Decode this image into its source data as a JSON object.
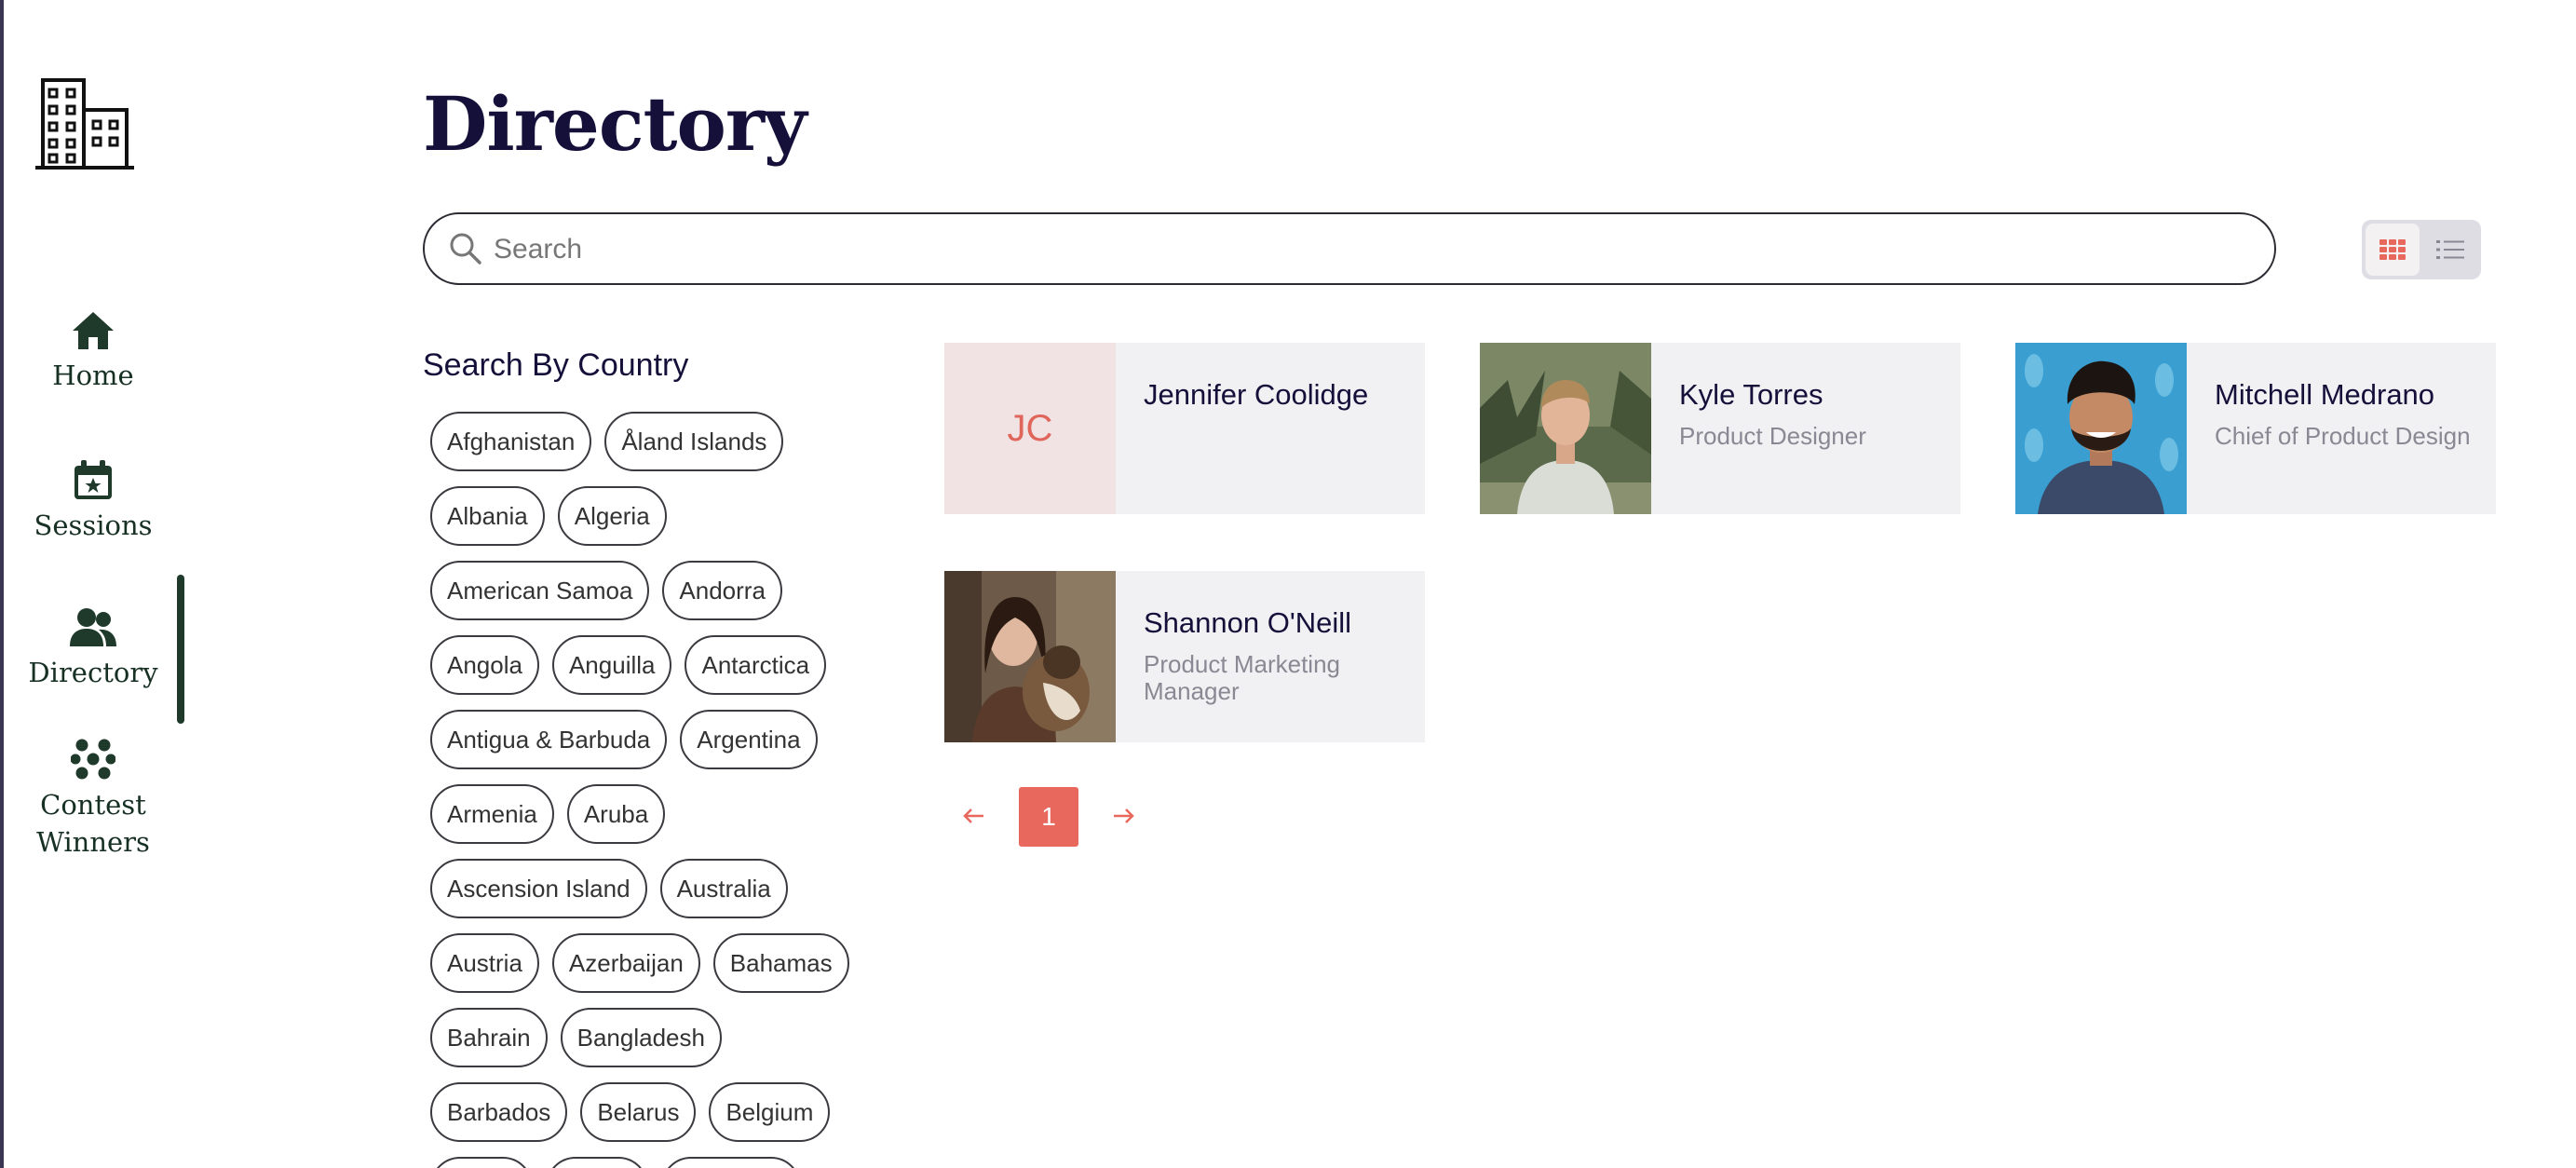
{
  "sidebar": {
    "logo_icon": "building-icon",
    "items": [
      {
        "label": "Home",
        "icon": "home-icon"
      },
      {
        "label": "Sessions",
        "icon": "calendar-star-icon"
      },
      {
        "label": "Directory",
        "icon": "people-icon",
        "active": true
      },
      {
        "label_line1": "Contest",
        "label_line2": "Winners",
        "icon": "dots-cluster-icon"
      }
    ]
  },
  "main": {
    "title": "Directory",
    "search": {
      "placeholder": "Search",
      "value": ""
    },
    "view_toggle": {
      "selected": "grid",
      "options": [
        "grid-icon",
        "list-icon"
      ]
    }
  },
  "filter": {
    "title": "Search By Country",
    "countries": [
      "Afghanistan",
      "Åland Islands",
      "Albania",
      "Algeria",
      "American Samoa",
      "Andorra",
      "Angola",
      "Anguilla",
      "Antarctica",
      "Antigua & Barbuda",
      "Argentina",
      "Armenia",
      "Aruba",
      "Ascension Island",
      "Australia",
      "Austria",
      "Azerbaijan",
      "Bahamas",
      "Bahrain",
      "Bangladesh",
      "Barbados",
      "Belarus",
      "Belgium"
    ]
  },
  "directory": {
    "people": [
      {
        "name": "Jennifer Coolidge",
        "role": "",
        "initials": "JC",
        "photo": "initials"
      },
      {
        "name": "Kyle Torres",
        "role": "Product Designer",
        "photo": "photo"
      },
      {
        "name": "Mitchell Medrano",
        "role": "Chief of Product Design",
        "photo": "photo"
      },
      {
        "name": "Shannon O'Neill",
        "role": "Product Marketing Manager",
        "photo": "photo"
      }
    ]
  },
  "pagination": {
    "current_page": "1"
  },
  "colors": {
    "accent": "#e8685d",
    "nav_text": "#173024",
    "title": "#15103a",
    "card_bg": "#f1f0f3"
  }
}
